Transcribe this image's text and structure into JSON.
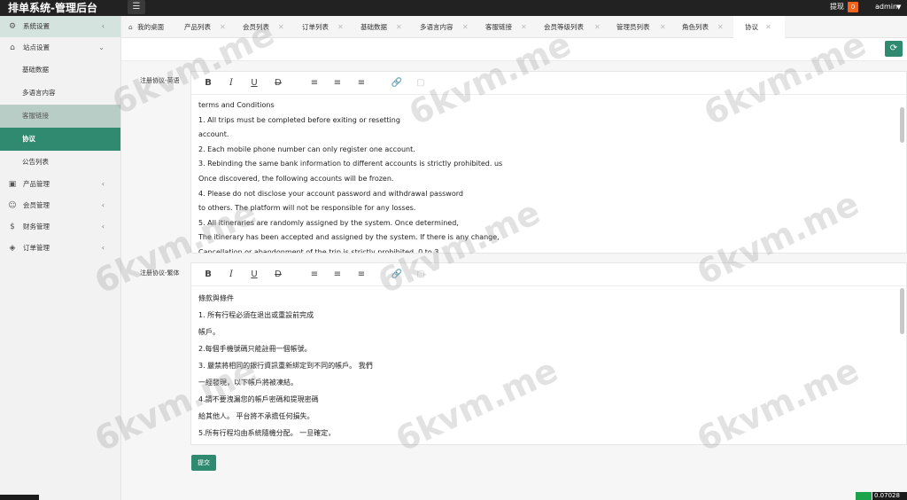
{
  "header": {
    "brand": "排单系统-管理后台",
    "menu_icon": "hamburger-icon",
    "withdraw_label": "提现",
    "withdraw_badge": "0",
    "user": "admin",
    "user_caret": "▼"
  },
  "sidebar": {
    "system": {
      "label": "系统设置",
      "icon": "gear-icon"
    },
    "site": {
      "label": "站点设置",
      "icon": "home-icon"
    },
    "site_children": [
      "基础数据",
      "多语言内容",
      "客服链接",
      "协议",
      "公告列表"
    ],
    "products": {
      "label": "产品管理",
      "icon": "cube-icon"
    },
    "members": {
      "label": "会员管理",
      "icon": "user-icon"
    },
    "finance": {
      "label": "财务管理",
      "icon": "dollar-icon"
    },
    "orders": {
      "label": "订单管理",
      "icon": "box-icon"
    }
  },
  "tabs": [
    {
      "label": "我的桌面",
      "closable": false
    },
    {
      "label": "产品列表",
      "closable": true
    },
    {
      "label": "会员列表",
      "closable": true
    },
    {
      "label": "订单列表",
      "closable": true
    },
    {
      "label": "基础数据",
      "closable": true
    },
    {
      "label": "多语言内容",
      "closable": true
    },
    {
      "label": "客服链接",
      "closable": true
    },
    {
      "label": "会员等级列表",
      "closable": true
    },
    {
      "label": "管理员列表",
      "closable": true
    },
    {
      "label": "角色列表",
      "closable": true
    },
    {
      "label": "协议",
      "closable": true,
      "active": true
    }
  ],
  "tab_close_glyph": "✕",
  "toolbar_glyphs": {
    "bold": "B",
    "italic": "I",
    "underline": "U",
    "strike": "D"
  },
  "form": {
    "en_label": "注册协议-英语",
    "zh_label": "注册协议-繁体",
    "en_lines": [
      "terms and Conditions",
      "1. All trips must be completed before exiting or resetting",
      "account.",
      "2. Each mobile phone number can only register one account.",
      "3. Rebinding the same bank information to different accounts is strictly prohibited. us",
      "Once discovered, the following accounts will be frozen.",
      "4. Please do not disclose your account password and withdrawal password",
      "to others. The platform will not be responsible for any losses.",
      "5. All itineraries are randomly assigned by the system. Once determined,",
      "The itinerary has been accepted and assigned by the system. If there is any change,",
      "Cancellation or abandonment of the trip is strictly prohibited. 0 to 3"
    ],
    "zh_lines": [
      "條款與條件",
      "1. 所有行程必須在退出或重設前完成",
      "帳戶。",
      "2.每個手機號碼只能註冊一個帳號。",
      "3. 嚴禁將相同的銀行資訊重新綁定到不同的帳戶。 我們",
      "一經發現，以下帳戶將被凍結。",
      "4.請不要洩漏您的帳戶密碼和提現密碼",
      "給其他人。 平台將不承擔任何損失。",
      "5.所有行程均由系統隨機分配。 一旦確定，"
    ],
    "submit_label": "提交"
  },
  "footer_badge": "0.07028",
  "watermark": "6kvm.me",
  "colors": {
    "accent": "#2f8a6f",
    "topbar": "#222222",
    "badge": "#f0641e"
  }
}
